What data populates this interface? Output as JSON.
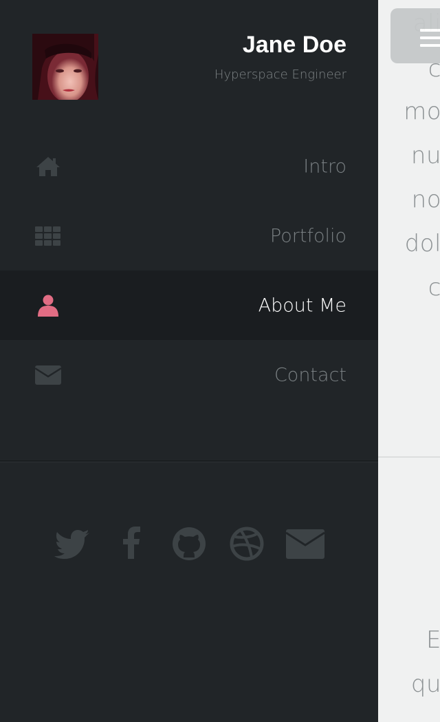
{
  "profile": {
    "name": "Jane Doe",
    "role": "Hyperspace Engineer"
  },
  "nav": {
    "items": [
      {
        "label": "Intro",
        "icon": "home-icon",
        "active": false
      },
      {
        "label": "Portfolio",
        "icon": "grid-icon",
        "active": false
      },
      {
        "label": "About Me",
        "icon": "user-icon",
        "active": true
      },
      {
        "label": "Contact",
        "icon": "envelope-icon",
        "active": false
      }
    ]
  },
  "social": [
    "twitter-icon",
    "facebook-icon",
    "github-icon",
    "dribbble-icon",
    "envelope-icon"
  ],
  "content_fragments": [
    "ali",
    "c",
    "mo",
    "nu",
    "no",
    "dol",
    "c",
    "E",
    "qu"
  ],
  "colors": {
    "sidebar_bg": "#212528",
    "active_bg": "#1a1d20",
    "accent": "#e26d84",
    "muted": "#7a8083",
    "icon_muted": "#3d4346"
  }
}
